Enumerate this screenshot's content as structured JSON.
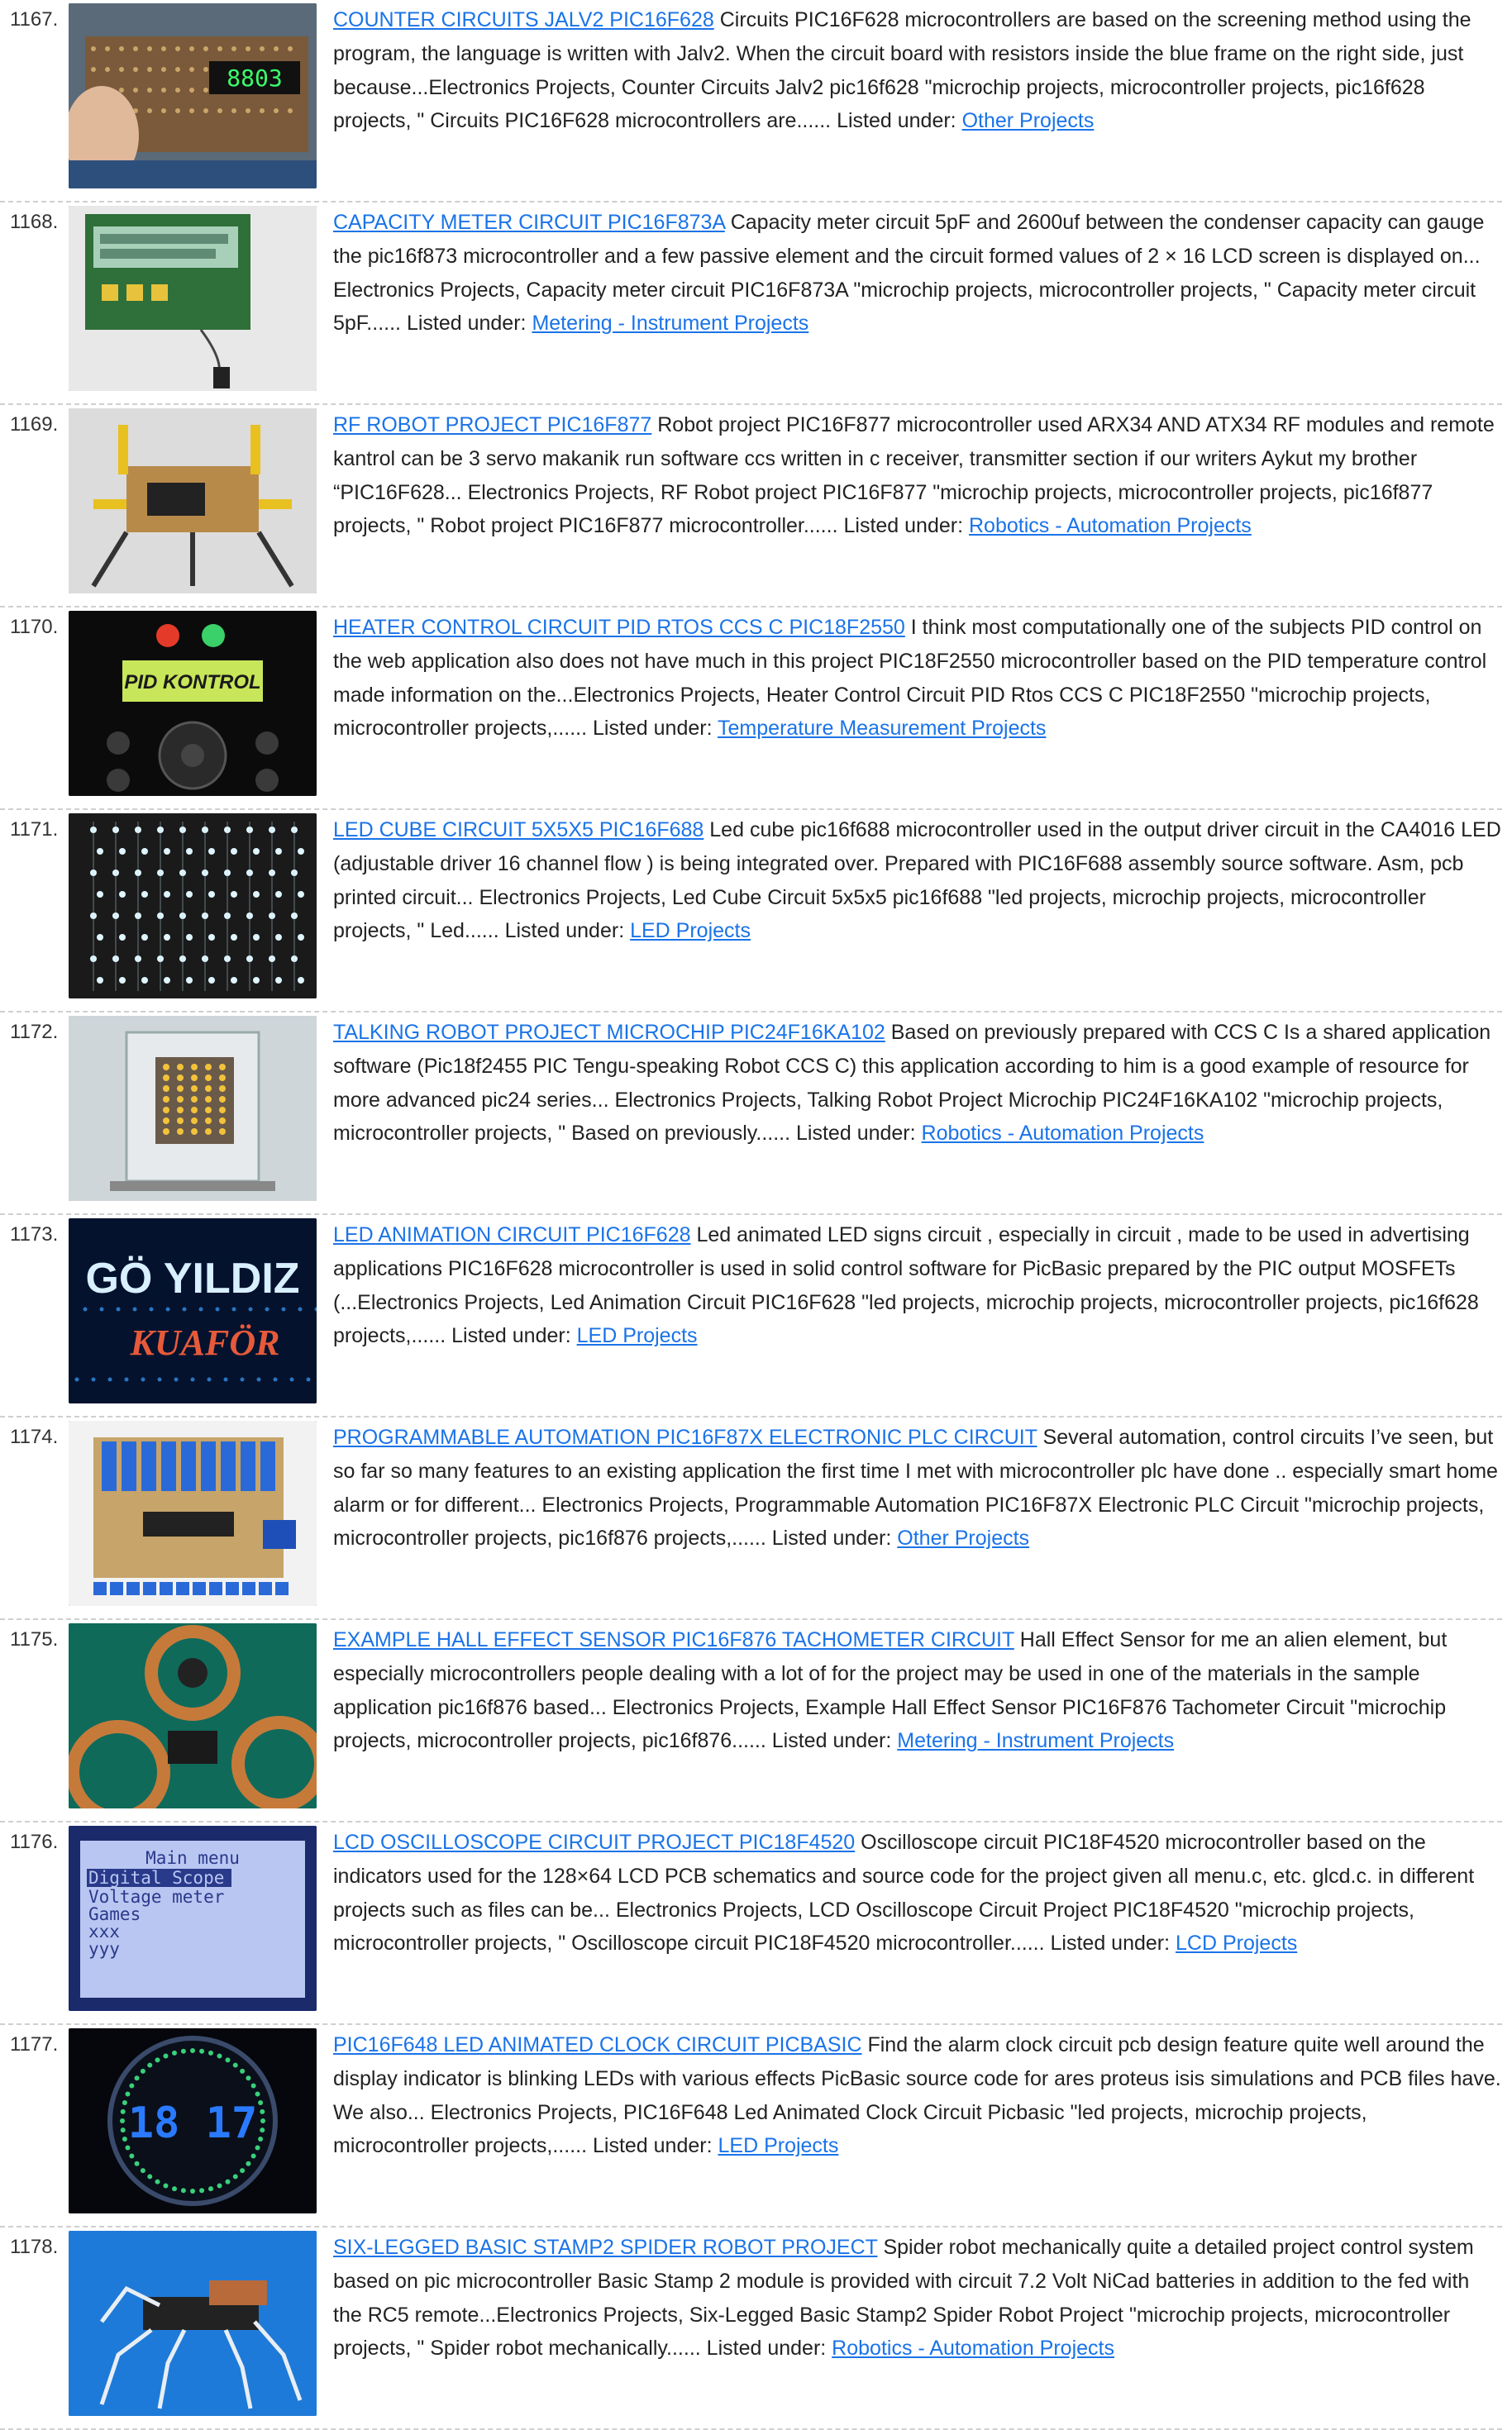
{
  "listed_label": "Listed under:",
  "entries": [
    {
      "num": "1167.",
      "title": "COUNTER CIRCUITS JALV2 PIC16F628",
      "text": "Circuits PIC16F628 microcontrollers are based on the screening method using the program, the language is written with Jalv2. When the circuit board with resistors inside the blue frame on the right side, just because...Electronics Projects, Counter Circuits Jalv2 pic16f628 \"microchip projects, microcontroller projects, pic16f628 projects, \" Circuits PIC16F628 microcontrollers are......",
      "category": "Other Projects",
      "thumb": "counter",
      "thumb_text": "8803"
    },
    {
      "num": "1168.",
      "title": "CAPACITY METER CIRCUIT PIC16F873A",
      "text": "Capacity meter circuit 5pF and 2600uf between the condenser capacity can gauge the pic16f873 microcontroller and a few passive element and the circuit formed values of 2 × 16 LCD screen is displayed on... Electronics Projects, Capacity meter circuit PIC16F873A \"microchip projects, microcontroller projects, \" Capacity meter circuit 5pF......",
      "category": "Metering - Instrument Projects",
      "thumb": "lcdgreen",
      "thumb_text": ""
    },
    {
      "num": "1169.",
      "title": "RF ROBOT PROJECT PIC16F877",
      "text": "Robot project PIC16F877 microcontroller used ARX34 AND ATX34 RF modules and remote kantrol can be 3 servo makanik run software ccs written in c receiver, transmitter section if our writers Aykut my brother “PIC16F628... Electronics Projects, RF Robot project PIC16F877 \"microchip projects, microcontroller projects, pic16f877 projects, \" Robot project PIC16F877 microcontroller......",
      "category": "Robotics - Automation Projects",
      "thumb": "robot",
      "thumb_text": ""
    },
    {
      "num": "1170.",
      "title": "HEATER CONTROL CIRCUIT PID RTOS CCS C PIC18F2550",
      "text": "I think most computationally one of the subjects PID control on the web application also does not have much in this project PIC18F2550 microcontroller based on the PID temperature control made information on the...Electronics Projects, Heater Control Circuit PID Rtos CCS C PIC18F2550 \"microchip projects, microcontroller projects,......",
      "category": "Temperature Measurement Projects",
      "thumb": "pid",
      "thumb_text": "PID KONTROL"
    },
    {
      "num": "1171.",
      "title": "LED CUBE CIRCUIT 5X5X5 PIC16F688",
      "text": "Led cube pic16f688 microcontroller used in the output driver circuit in the CA4016 LED (adjustable driver 16 channel flow ) is being integrated over. Prepared with PIC16F688 assembly source software. Asm, pcb printed circuit... Electronics Projects, Led Cube Circuit 5x5x5 pic16f688 \"led projects, microchip projects, microcontroller projects, \" Led......",
      "category": "LED Projects",
      "thumb": "cube",
      "thumb_text": ""
    },
    {
      "num": "1172.",
      "title": "TALKING ROBOT PROJECT MICROCHIP PIC24F16KA102",
      "text": "Based on previously prepared with CCS C Is a shared application software (Pic18f2455 PIC Tengu-speaking Robot CCS C) this application according to him is a good example of resource for more advanced pic24 series... Electronics Projects, Talking Robot Project Microchip PIC24F16KA102 \"microchip projects, microcontroller projects, \" Based on previously......",
      "category": "Robotics - Automation Projects",
      "thumb": "talking",
      "thumb_text": ""
    },
    {
      "num": "1173.",
      "title": "LED ANIMATION CIRCUIT PIC16F628",
      "text": "Led animated LED signs circuit , especially in circuit , made to be used in advertising applications PIC16F628 microcontroller is used in solid control software for PicBasic prepared by the PIC output MOSFETs (...Electronics Projects, Led Animation Circuit PIC16F628 \"led projects, microchip projects, microcontroller projects, pic16f628 projects,......",
      "category": "LED Projects",
      "thumb": "neon",
      "thumb_text": "GÖ YILDIZ|KUAFÖR"
    },
    {
      "num": "1174.",
      "title": "PROGRAMMABLE AUTOMATION PIC16F87X ELECTRONIC PLC CIRCUIT",
      "text": "Several automation, control circuits I’ve seen, but so far so many features to an existing application the first time I met with microcontroller plc have done .. especially smart home alarm or for different... Electronics Projects, Programmable Automation PIC16F87X Electronic PLC Circuit \"microchip projects, microcontroller projects, pic16f876 projects,......",
      "category": "Other Projects",
      "thumb": "plc",
      "thumb_text": ""
    },
    {
      "num": "1175.",
      "title": "EXAMPLE HALL EFFECT SENSOR PIC16F876 TACHOMETER CIRCUIT",
      "text": "Hall Effect Sensor for me an alien element, but especially microcontrollers people dealing with a lot of for the project may be used in one of the materials in the sample application pic16f876 based... Electronics Projects, Example Hall Effect Sensor PIC16F876 Tachometer Circuit \"microchip projects, microcontroller projects, pic16f876......",
      "category": "Metering - Instrument Projects",
      "thumb": "hall",
      "thumb_text": ""
    },
    {
      "num": "1176.",
      "title": "LCD OSCILLOSCOPE CIRCUIT PROJECT PIC18F4520",
      "text": "Oscilloscope circuit PIC18F4520 microcontroller based on the indicators used for the 128×64 LCD PCB schematics and source code for the project given all menu.c, etc. glcd.c. in different projects such as files can be... Electronics Projects, LCD Oscilloscope Circuit Project PIC18F4520 \"microchip projects, microcontroller projects, \" Oscilloscope circuit PIC18F4520 microcontroller......",
      "category": "LCD Projects",
      "thumb": "osc",
      "thumb_text": "Main menu|Digital Scope|Voltage meter|Games|xxx|yyy"
    },
    {
      "num": "1177.",
      "title": "PIC16F648 LED ANIMATED CLOCK CIRCUIT PICBASIC",
      "text": "Find the alarm clock circuit pcb design feature quite well around the display indicator is blinking LEDs with various effects PicBasic source code for ares proteus isis simulations and PCB files have. We also... Electronics Projects, PIC16F648 Led Animated Clock Circuit Picbasic \"led projects, microchip projects, microcontroller projects,......",
      "category": "LED Projects",
      "thumb": "clock",
      "thumb_text": "18 17"
    },
    {
      "num": "1178.",
      "title": "SIX-LEGGED BASIC STAMP2 SPIDER ROBOT PROJECT",
      "text": "Spider robot mechanically quite a detailed project control system based on pic microcontroller Basic Stamp 2 module is provided with circuit 7.2 Volt NiCad batteries in addition to the fed with the RC5 remote...Electronics Projects, Six-Legged Basic Stamp2 Spider Robot Project \"microchip projects, microcontroller projects, \" Spider robot mechanically......",
      "category": "Robotics - Automation Projects",
      "thumb": "spider",
      "thumb_text": ""
    }
  ]
}
